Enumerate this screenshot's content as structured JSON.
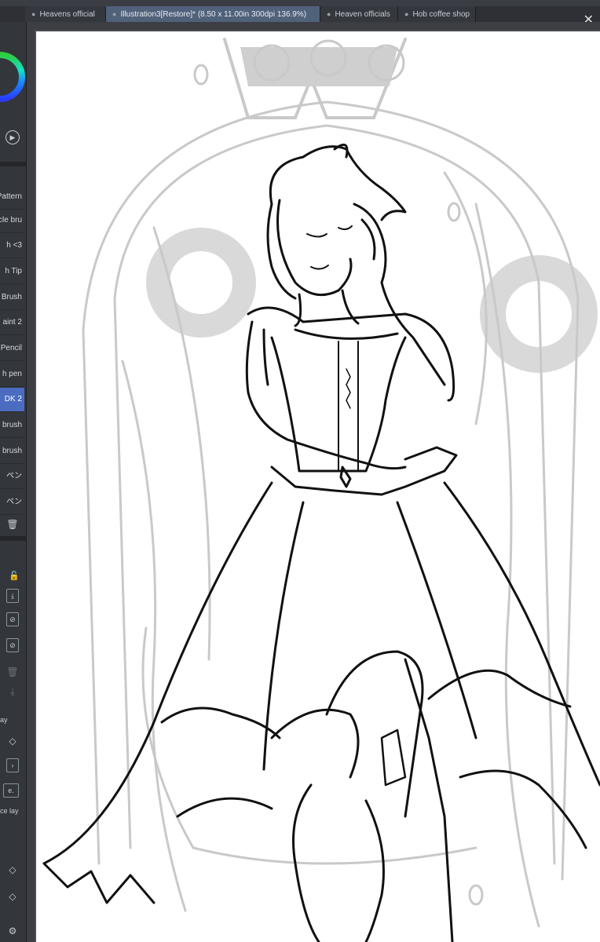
{
  "tabs": [
    {
      "label": "Heavens official",
      "active": false
    },
    {
      "label": "Illustration3[Restore]* (8.50 x 11.00in 300dpi 136.9%)",
      "active": true
    },
    {
      "label": "Heaven officials",
      "active": false
    },
    {
      "label": "Hob coffee shop",
      "active": false
    }
  ],
  "close_glyph": "✕",
  "brushes": [
    {
      "label": "Pattern"
    },
    {
      "label": "cle bru"
    },
    {
      "label": "h <3"
    },
    {
      "label": "h Tip"
    },
    {
      "label": "Brush"
    },
    {
      "label": "aint 2"
    },
    {
      "label": "Pencil"
    },
    {
      "label": "h pen"
    },
    {
      "label": "DK 2",
      "selected": true
    },
    {
      "label": "brush"
    },
    {
      "label": "brush"
    },
    {
      "label": "ペン"
    },
    {
      "label": "ペン"
    }
  ],
  "layer_panel": {
    "ay_label": "ay",
    "mode_label": "e.",
    "ref_label": "ce lay"
  },
  "icons": {
    "play": "play-circle-icon",
    "trash": "trash-icon",
    "lock": "lock-icon"
  },
  "colors": {
    "accent": "#4b6cc0",
    "panel": "#33363b",
    "active_tab": "#50617a"
  }
}
